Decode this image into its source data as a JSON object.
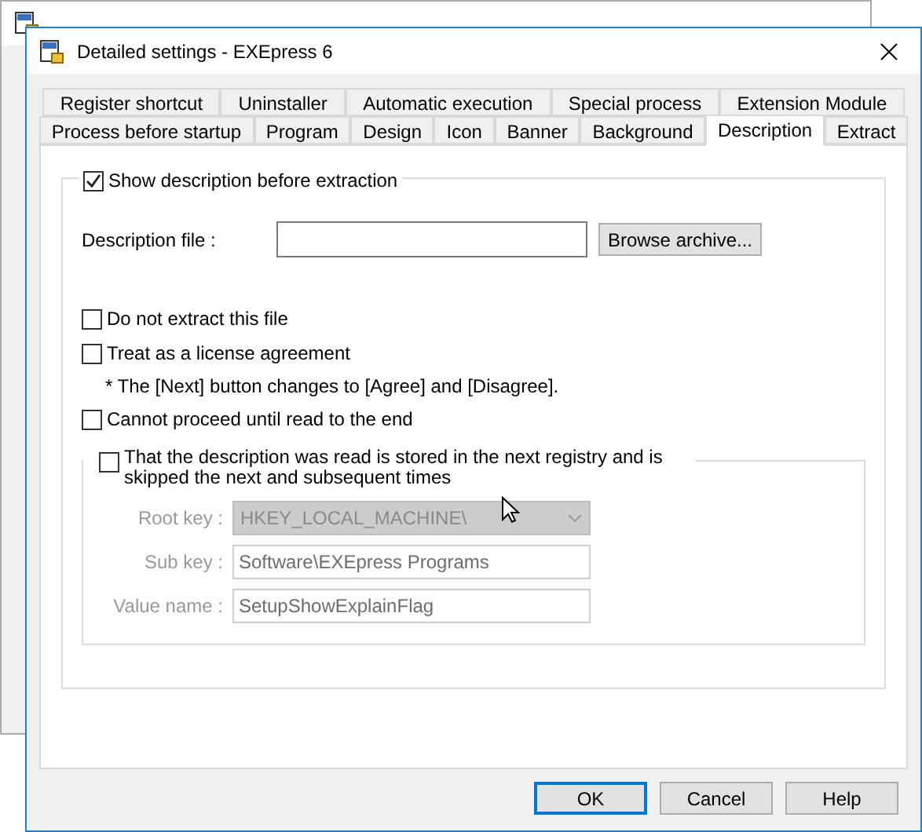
{
  "dialog": {
    "title": "Detailed settings - EXEpress 6",
    "tab_rows": [
      [
        {
          "label": "Register shortcut",
          "selected": false
        },
        {
          "label": "Uninstaller",
          "selected": false
        },
        {
          "label": "Automatic execution",
          "selected": false
        },
        {
          "label": "Special process",
          "selected": false
        },
        {
          "label": "Extension Module",
          "selected": false
        }
      ],
      [
        {
          "label": "Process before startup",
          "selected": false
        },
        {
          "label": "Program",
          "selected": false
        },
        {
          "label": "Design",
          "selected": false
        },
        {
          "label": "Icon",
          "selected": false
        },
        {
          "label": "Banner",
          "selected": false
        },
        {
          "label": "Background",
          "selected": false
        },
        {
          "label": "Description",
          "selected": true
        },
        {
          "label": "Extract",
          "selected": false
        }
      ]
    ],
    "show_description": {
      "label": "Show description before extraction",
      "checked": true
    },
    "description_file": {
      "label": "Description file :",
      "button": "Browse archive..."
    },
    "options": [
      {
        "label": "Do not extract this file",
        "checked": false
      },
      {
        "label": "Treat as a license agreement",
        "checked": false,
        "note": "* The [Next] button changes to [Agree] and [Disagree]."
      },
      {
        "label": "Cannot proceed until read to the end",
        "checked": false
      }
    ],
    "registry": {
      "label": "That the description was read is stored in the next registry and is skipped the next and subsequent times",
      "checked": false,
      "disabled": true,
      "fields": [
        {
          "kind": "dropdown",
          "label": "Root key :",
          "value": "HKEY_LOCAL_MACHINE\\"
        },
        {
          "kind": "text",
          "label": "Sub key :",
          "value": "Software\\EXEpress Programs"
        },
        {
          "kind": "text",
          "label": "Value name :",
          "value": "SetupShowExplainFlag"
        }
      ]
    },
    "buttons": [
      {
        "label": "OK",
        "default": true
      },
      {
        "label": "Cancel",
        "default": false
      },
      {
        "label": "Help",
        "default": false
      }
    ]
  }
}
